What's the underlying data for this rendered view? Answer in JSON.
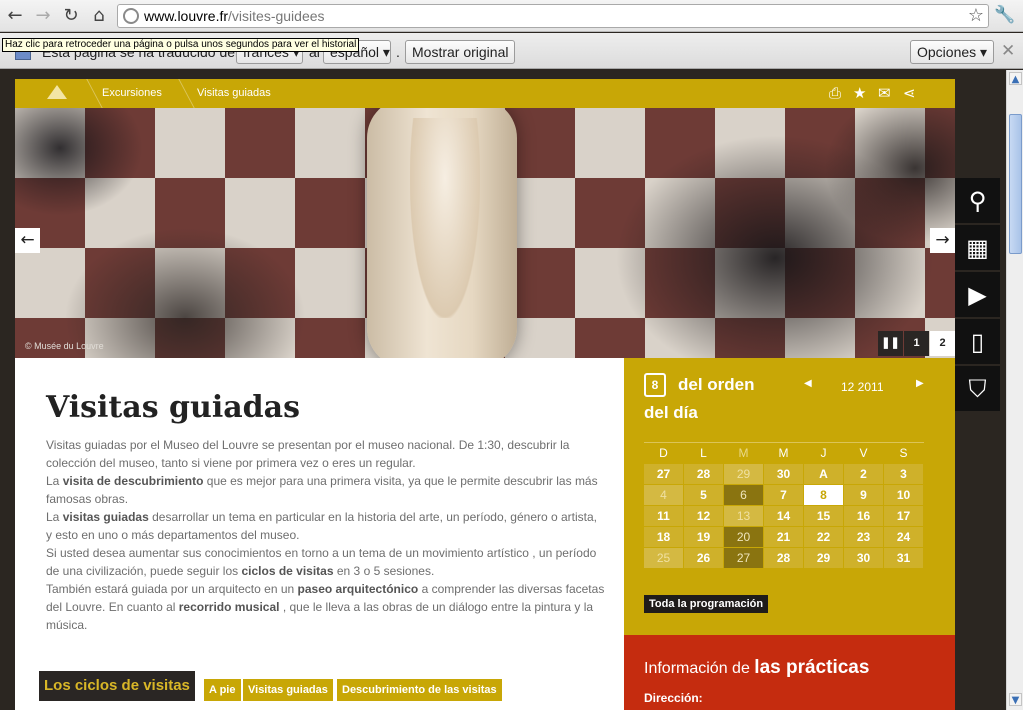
{
  "browser": {
    "url_domain": "www.louvre.fr",
    "url_path": "/visites-guidees",
    "back_tooltip": "Haz clic para retroceder una página o pulsa unos segundos para ver el historial"
  },
  "translate_bar": {
    "message_start": "Esta página se ha traducido del",
    "from_lang": "francés",
    "message_mid": "al",
    "to_lang": "español",
    "period": ".",
    "show_original": "Mostrar original",
    "options": "Opciones"
  },
  "header": {
    "breadcrumbs": [
      "Excursiones",
      "Visitas guiadas"
    ]
  },
  "hero": {
    "credit": "© Musée du Louvre",
    "slides": [
      "1",
      "2"
    ],
    "active_slide": "2"
  },
  "content": {
    "title": "Visitas guiadas",
    "p1": "Visitas guiadas por el Museo del Louvre se presentan por el museo nacional. De 1:30, descubrir la colección del museo, tanto si viene por primera vez o eres un regular.",
    "p2_prefix": "La",
    "p2_bold": "visita de descubrimiento",
    "p2_rest": "que es mejor para una primera visita, ya que le permite descubrir las más famosas obras.",
    "p3_prefix": "La",
    "p3_bold": "visitas guiadas",
    "p3_rest": "desarrollar un tema en particular en la historia del arte, un período, género o artista, y esto en uno o más departamentos del museo.",
    "p4_start": "Si usted desea aumentar sus conocimientos en torno a un tema de un movimiento artístico , un período de una civilización, puede seguir los",
    "p4_bold": "ciclos de visitas",
    "p4_end": "en 3 o 5 sesiones.",
    "p5_start": "También estará guiada por un arquitecto en un",
    "p5_bold1": "paseo arquitectónico",
    "p5_mid": "a comprender las diversas facetas del Louvre. En cuanto al",
    "p5_bold2": "recorrido musical",
    "p5_end": ", que le lleva a las obras de un diálogo entre la pintura y la música."
  },
  "tabs": {
    "active": "Los ciclos de visitas",
    "items": [
      "A pie",
      "Visitas guiadas",
      "Descubrimiento de las visitas"
    ]
  },
  "agenda": {
    "icon_day": "8",
    "title_line1": "del orden",
    "title_line2": "del día",
    "month": "12 2011",
    "weekdays": [
      "D",
      "L",
      "M",
      "M",
      "J",
      "V",
      "S"
    ],
    "weeks": [
      [
        "27",
        "28",
        "29",
        "30",
        "A",
        "2",
        "3"
      ],
      [
        "4",
        "5",
        "6",
        "7",
        "8",
        "9",
        "10"
      ],
      [
        "11",
        "12",
        "13",
        "14",
        "15",
        "16",
        "17"
      ],
      [
        "18",
        "19",
        "20",
        "21",
        "22",
        "23",
        "24"
      ],
      [
        "25",
        "26",
        "27",
        "28",
        "29",
        "30",
        "31"
      ]
    ],
    "all_link": "Toda la programación"
  },
  "practical": {
    "title_prefix": "Información de",
    "title_bold": "las prácticas",
    "address_label": "Dirección:"
  },
  "colors": {
    "gold": "#c8a706",
    "dark": "#2a2624",
    "red": "#c52c0f"
  }
}
